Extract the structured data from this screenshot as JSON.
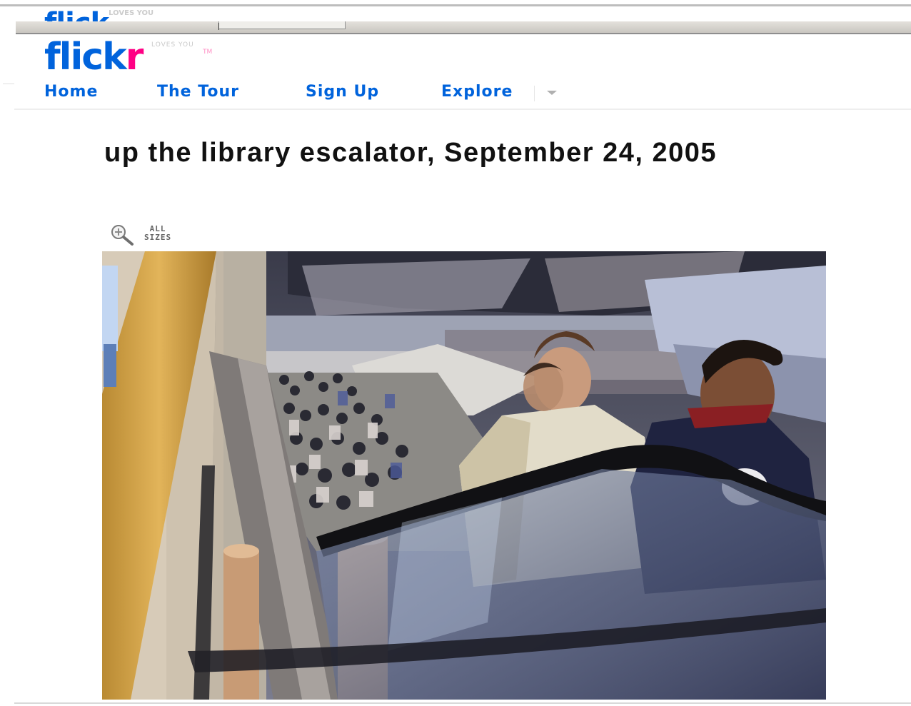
{
  "header": {
    "logo_main": "flick",
    "logo_accent": "r",
    "logo_tagline": "LOVES YOU",
    "logo_trademark": "TM"
  },
  "nav": {
    "items": [
      {
        "label": "Home"
      },
      {
        "label": "The Tour"
      },
      {
        "label": "Sign Up"
      },
      {
        "label": "Explore"
      }
    ],
    "explore_menu_icon": "chevron-down-icon"
  },
  "photo": {
    "title": "up the library escalator, September 24, 2005",
    "all_sizes_line1": "ALL",
    "all_sizes_line2": "SIZES",
    "zoom_icon": "magnifier-icon"
  },
  "colors": {
    "brand_blue": "#0063dc",
    "brand_pink": "#ff0084",
    "title_text": "#111111"
  }
}
